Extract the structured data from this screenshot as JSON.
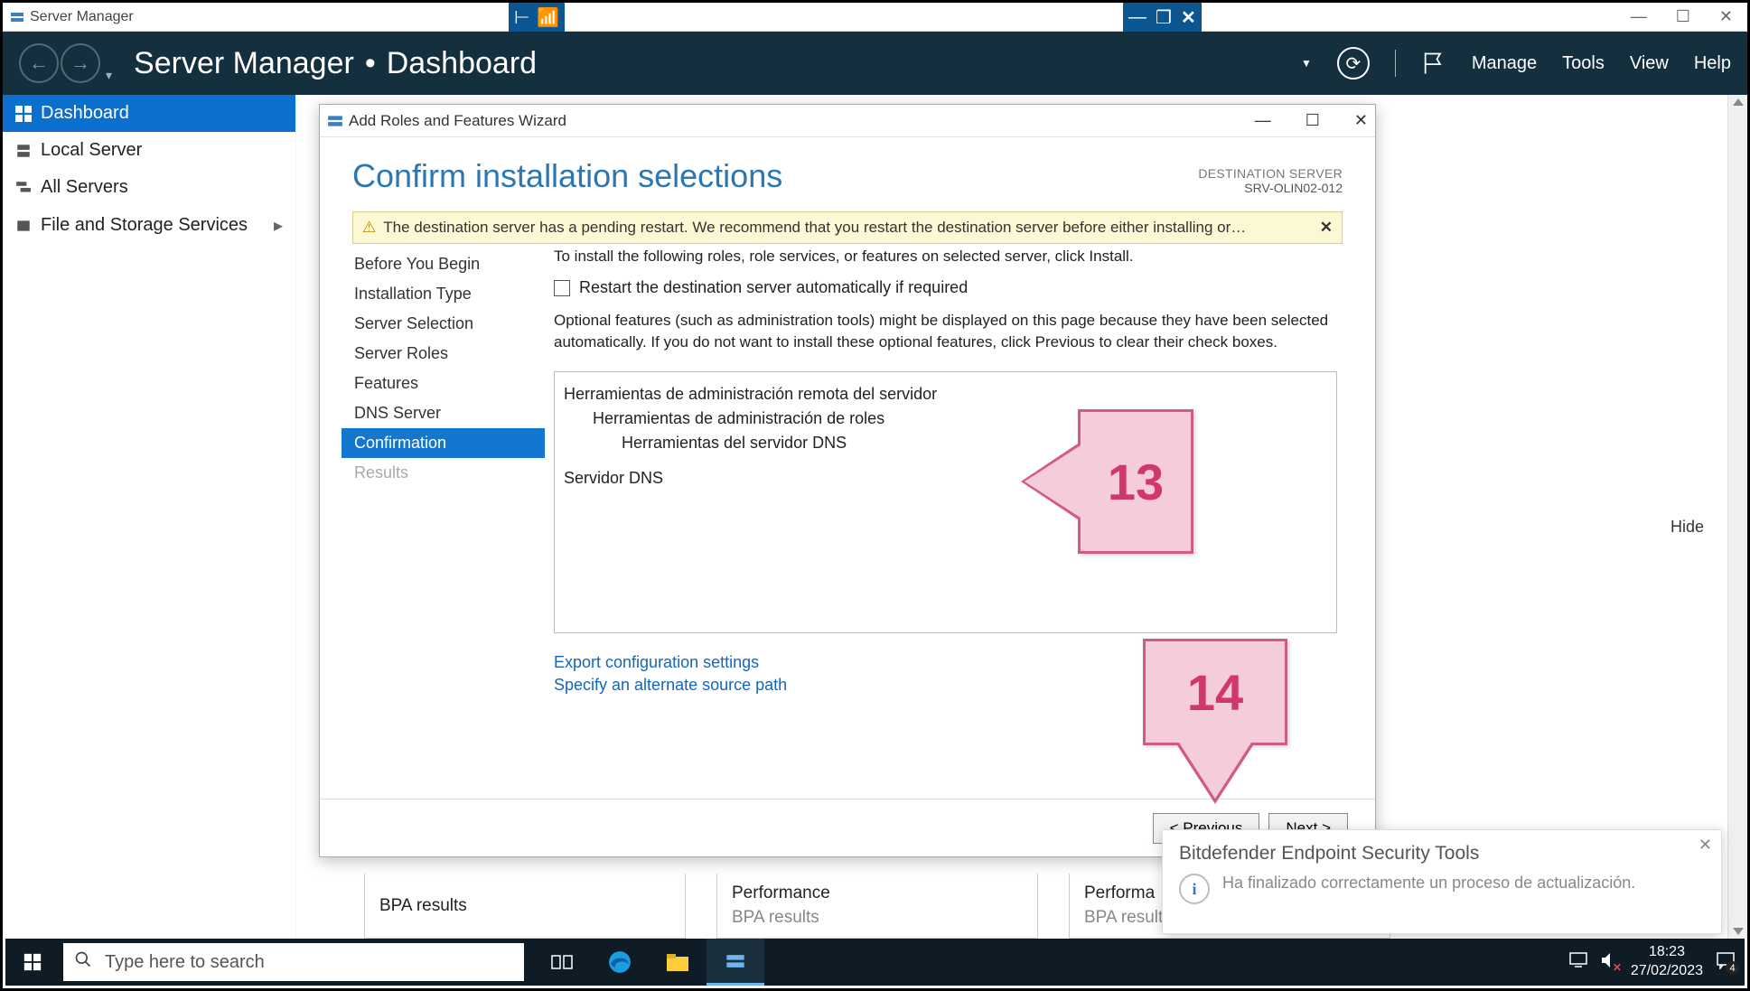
{
  "outer": {
    "title": "Server Manager"
  },
  "header": {
    "app": "Server Manager",
    "crumb": "Dashboard",
    "menu": {
      "manage": "Manage",
      "tools": "Tools",
      "view": "View",
      "help": "Help"
    }
  },
  "sidebar": {
    "items": [
      {
        "label": "Dashboard"
      },
      {
        "label": "Local Server"
      },
      {
        "label": "All Servers"
      },
      {
        "label": "File and Storage Services"
      }
    ]
  },
  "hide": "Hide",
  "tiles": {
    "a1": "BPA results",
    "b1": "Performance",
    "b2": "BPA results",
    "c1": "Performa",
    "c2": "BPA results"
  },
  "wizard": {
    "title": "Add Roles and Features Wizard",
    "heading": "Confirm installation selections",
    "dest_label": "DESTINATION SERVER",
    "dest_server": "SRV-OLIN02-012",
    "warning": "The destination server has a pending restart. We recommend that you restart the destination server before either installing or…",
    "steps": [
      "Before You Begin",
      "Installation Type",
      "Server Selection",
      "Server Roles",
      "Features",
      "DNS Server",
      "Confirmation",
      "Results"
    ],
    "desc": "To install the following roles, role services, or features on selected server, click Install.",
    "checkbox": "Restart the destination server automatically if required",
    "note": "Optional features (such as administration tools) might be displayed on this page because they have been selected automatically. If you do not want to install these optional features, click Previous to clear their check boxes.",
    "selections": {
      "l0a": "Herramientas de administración remota del servidor",
      "l1a": "Herramientas de administración de roles",
      "l2a": "Herramientas del servidor DNS",
      "l0b": "Servidor DNS"
    },
    "link_export": "Export configuration settings",
    "link_alt": "Specify an alternate source path",
    "btn_prev": "< Previous",
    "btn_next": "Next >"
  },
  "callouts": {
    "c13": "13",
    "c14": "14"
  },
  "toast": {
    "title": "Bitdefender Endpoint Security Tools",
    "body": "Ha finalizado correctamente un proceso de actualización."
  },
  "taskbar": {
    "search_placeholder": "Type here to search",
    "time": "18:23",
    "date": "27/02/2023",
    "notif_count": "4"
  }
}
